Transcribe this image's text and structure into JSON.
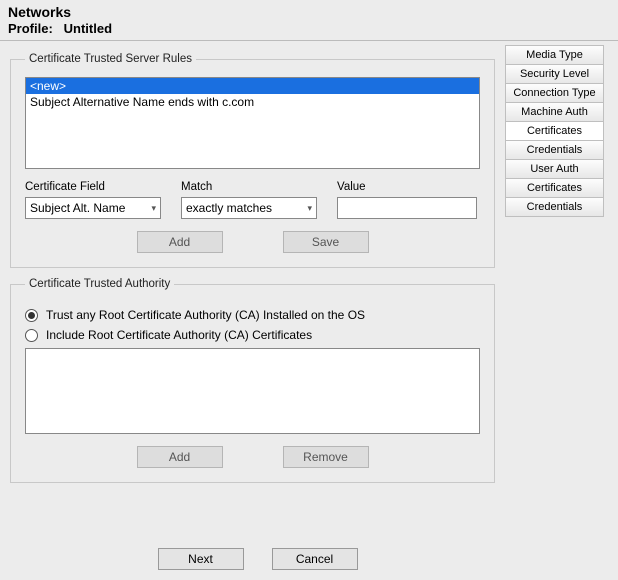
{
  "header": {
    "title": "Networks",
    "profile_label": "Profile:",
    "profile_name": "Untitled"
  },
  "tabs": [
    {
      "label": "Media Type",
      "active": false
    },
    {
      "label": "Security Level",
      "active": false
    },
    {
      "label": "Connection Type",
      "active": false
    },
    {
      "label": "Machine Auth",
      "active": false
    },
    {
      "label": "Certificates",
      "active": true
    },
    {
      "label": "Credentials",
      "active": false
    },
    {
      "label": "User Auth",
      "active": false
    },
    {
      "label": "Certificates",
      "active": false
    },
    {
      "label": "Credentials",
      "active": false
    }
  ],
  "rules_group": {
    "legend": "Certificate Trusted Server Rules",
    "list": [
      {
        "text": "<new>",
        "selected": true
      },
      {
        "text": "Subject Alternative Name ends with c.com",
        "selected": false
      }
    ],
    "field_labels": {
      "cert_field": "Certificate Field",
      "match": "Match",
      "value": "Value"
    },
    "cert_field_value": "Subject Alt. Name",
    "match_value": "exactly matches",
    "value_text": "",
    "add_label": "Add",
    "save_label": "Save"
  },
  "authority_group": {
    "legend": "Certificate Trusted Authority",
    "radio_trust_label": "Trust any Root Certificate Authority (CA) Installed on the OS",
    "radio_include_label": "Include Root Certificate Authority (CA) Certificates",
    "selected": "trust",
    "add_label": "Add",
    "remove_label": "Remove"
  },
  "footer": {
    "next_label": "Next",
    "cancel_label": "Cancel"
  }
}
